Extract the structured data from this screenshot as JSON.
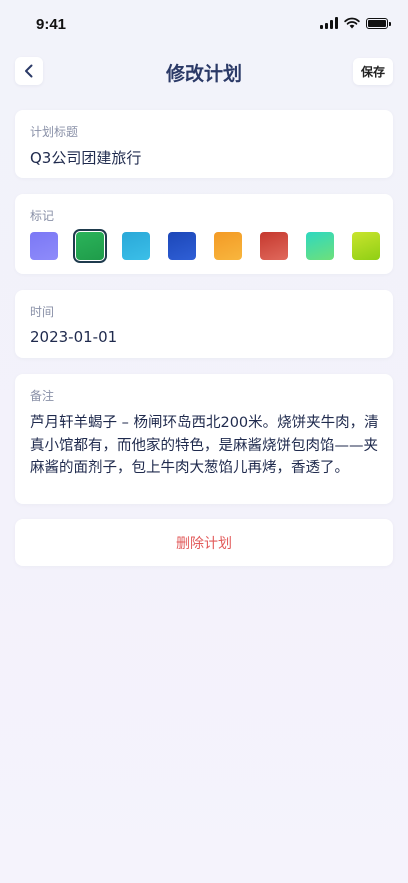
{
  "status": {
    "time": "9:41"
  },
  "nav": {
    "title": "修改计划",
    "save_label": "保存"
  },
  "plan_title": {
    "label": "计划标题",
    "value": "Q3公司团建旅行"
  },
  "mark": {
    "label": "标记",
    "selected_index": 1,
    "swatches": [
      {
        "name": "purple",
        "from": "#7b78f5",
        "to": "#8e8bfa"
      },
      {
        "name": "green",
        "from": "#2bb35a",
        "to": "#1f9c4a"
      },
      {
        "name": "sky-blue",
        "from": "#2aa8d8",
        "to": "#3bbfe8"
      },
      {
        "name": "navy-blue",
        "from": "#1c47b8",
        "to": "#2f5fd6"
      },
      {
        "name": "orange",
        "from": "#f39a25",
        "to": "#f8b63e"
      },
      {
        "name": "red",
        "from": "#c5382e",
        "to": "#e0695c"
      },
      {
        "name": "teal-green",
        "from": "#2ed8c0",
        "to": "#6ee07a"
      },
      {
        "name": "lime",
        "from": "#c9e42e",
        "to": "#8fcf14"
      }
    ]
  },
  "time": {
    "label": "时间",
    "value": "2023-01-01"
  },
  "note": {
    "label": "备注",
    "value": "芦月轩羊蝎子 – 杨闸环岛西北200米。烧饼夹牛肉，清真小馆都有，而他家的特色，是麻酱烧饼包肉馅——夹麻酱的面剂子，包上牛肉大葱馅儿再烤，香透了。"
  },
  "delete_label": "删除计划"
}
